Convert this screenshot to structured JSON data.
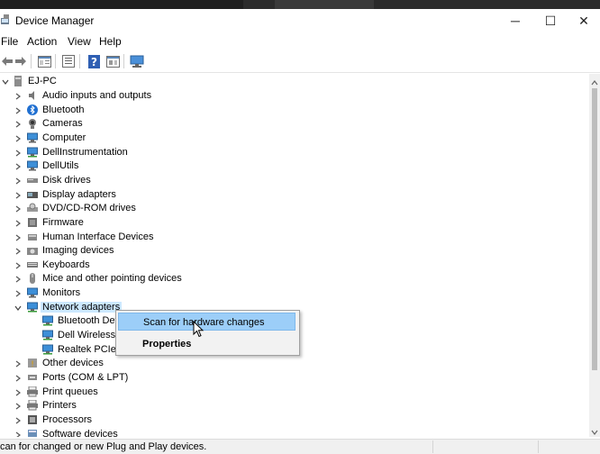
{
  "window": {
    "title": "Device Manager",
    "app_icon": "device-manager-icon",
    "controls": {
      "minimize": "─",
      "maximize": "☐",
      "close": "✕"
    }
  },
  "menubar": [
    "File",
    "Action",
    "View",
    "Help"
  ],
  "toolbar": {
    "buttons": [
      "back-arrow-icon",
      "forward-arrow-icon",
      "properties-sheet-icon",
      "list-view-icon",
      "help-icon",
      "update-driver-icon",
      "monitor-scan-icon"
    ]
  },
  "tree": {
    "root": {
      "label": "EJ-PC",
      "expanded": true,
      "icon": "computer-icon"
    },
    "items": [
      {
        "label": "Audio inputs and outputs",
        "icon": "speaker-icon",
        "expanded": false
      },
      {
        "label": "Bluetooth",
        "icon": "bluetooth-icon",
        "expanded": false
      },
      {
        "label": "Cameras",
        "icon": "camera-icon",
        "expanded": false
      },
      {
        "label": "Computer",
        "icon": "monitor-icon",
        "expanded": false
      },
      {
        "label": "DellInstrumentation",
        "icon": "network-monitor-icon",
        "expanded": false
      },
      {
        "label": "DellUtils",
        "icon": "monitor-icon",
        "expanded": false
      },
      {
        "label": "Disk drives",
        "icon": "disk-drive-icon",
        "expanded": false
      },
      {
        "label": "Display adapters",
        "icon": "display-adapter-icon",
        "expanded": false
      },
      {
        "label": "DVD/CD-ROM drives",
        "icon": "dvd-icon",
        "expanded": false
      },
      {
        "label": "Firmware",
        "icon": "firmware-icon",
        "expanded": false
      },
      {
        "label": "Human Interface Devices",
        "icon": "hid-icon",
        "expanded": false
      },
      {
        "label": "Imaging devices",
        "icon": "imaging-icon",
        "expanded": false
      },
      {
        "label": "Keyboards",
        "icon": "keyboard-icon",
        "expanded": false
      },
      {
        "label": "Mice and other pointing devices",
        "icon": "mouse-icon",
        "expanded": false
      },
      {
        "label": "Monitors",
        "icon": "monitor-icon",
        "expanded": false
      },
      {
        "label": "Network adapters",
        "icon": "network-adapter-icon",
        "expanded": true,
        "selected": true
      },
      {
        "label": "Bluetooth Dev",
        "icon": "network-adapter-icon",
        "child": true
      },
      {
        "label": "Dell Wireless 1",
        "icon": "network-adapter-icon",
        "child": true
      },
      {
        "label": "Realtek PCIe G",
        "icon": "network-adapter-icon",
        "child": true
      },
      {
        "label": "Other devices",
        "icon": "other-device-icon",
        "expanded": false
      },
      {
        "label": "Ports (COM & LPT)",
        "icon": "port-icon",
        "expanded": false
      },
      {
        "label": "Print queues",
        "icon": "printer-icon",
        "expanded": false
      },
      {
        "label": "Printers",
        "icon": "printer-icon",
        "expanded": false
      },
      {
        "label": "Processors",
        "icon": "processor-icon",
        "expanded": false
      },
      {
        "label": "Software devices",
        "icon": "software-device-icon",
        "expanded": false
      }
    ]
  },
  "context_menu": {
    "items": [
      {
        "label": "Scan for hardware changes",
        "highlighted": true
      },
      {
        "label": "Properties",
        "bold": true
      }
    ]
  },
  "statusbar": {
    "text": "can for changed or new Plug and Play devices."
  },
  "colors": {
    "selection": "#cce8ff",
    "menu_highlight": "#9ccef8",
    "accent": "#1e7fd6"
  }
}
